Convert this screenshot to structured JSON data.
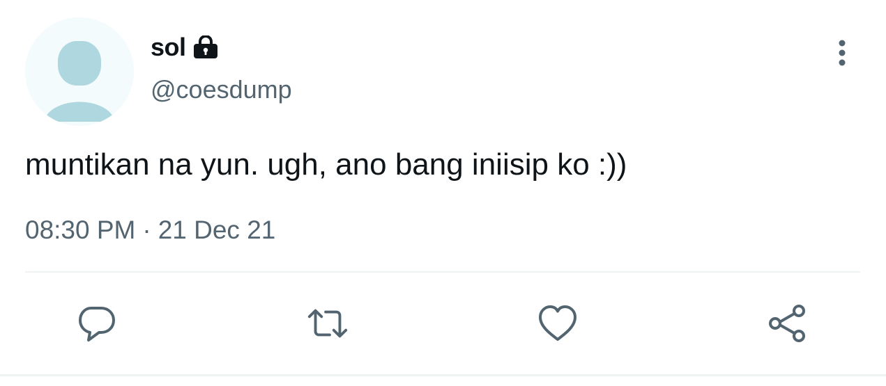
{
  "author": {
    "display_name": "sol",
    "handle": "@coesdump",
    "protected_icon": "lock-icon"
  },
  "tweet": {
    "text": "muntikan na yun. ugh, ano bang iniisip ko :))",
    "time": "08:30 PM",
    "separator": "·",
    "date": "21 Dec 21"
  },
  "actions": [
    {
      "name": "reply",
      "icon": "comment-icon"
    },
    {
      "name": "retweet",
      "icon": "retweet-icon"
    },
    {
      "name": "like",
      "icon": "heart-icon"
    },
    {
      "name": "share",
      "icon": "share-icon"
    }
  ],
  "menu": {
    "icon": "more-vertical-icon"
  },
  "colors": {
    "text_primary": "#0f1419",
    "text_secondary": "#536471",
    "icon_gray": "#536471",
    "avatar_bg": "#f3fbfc",
    "avatar_figure": "#aed7df",
    "divider": "#eff3f4"
  }
}
